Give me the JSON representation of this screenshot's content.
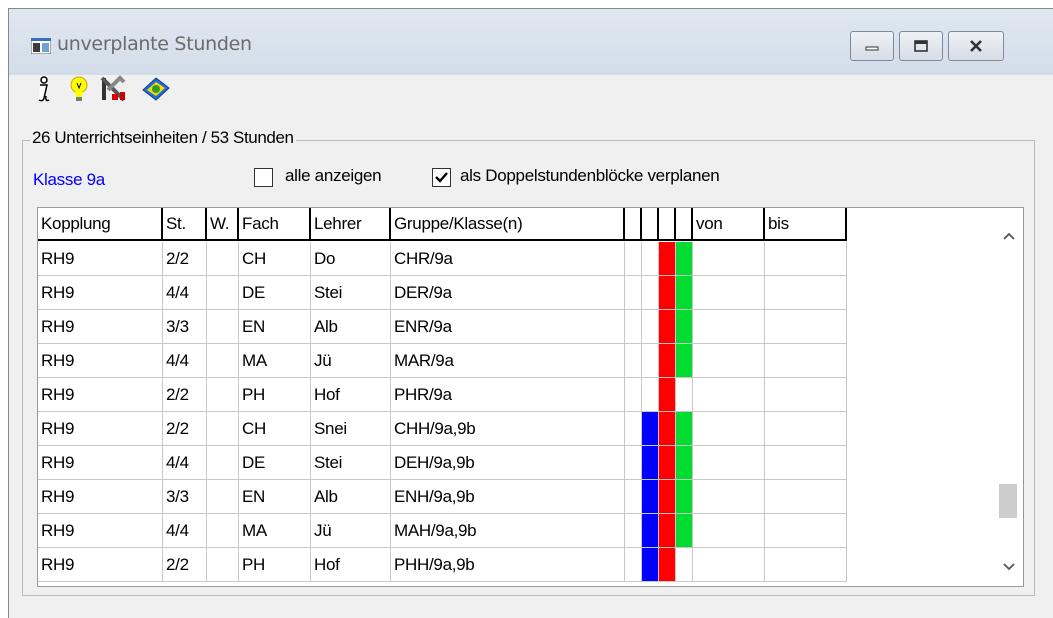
{
  "window": {
    "title": "unverplante Stunden",
    "buttons": [
      "minimize-icon",
      "maximize-icon",
      "close-icon"
    ]
  },
  "toolbar": {
    "icons": [
      "info-icon",
      "hint-bulb-icon",
      "tools-icon",
      "help-book-icon"
    ]
  },
  "group": {
    "title": "26 Unterrichtseinheiten / 53 Stunden",
    "klasse_label": "Klasse 9a",
    "show_all_label": "alle anzeigen",
    "show_all_checked": false,
    "double_block_label": "als Doppelstundenblöcke verplanen",
    "double_block_checked": true
  },
  "table": {
    "headers": [
      "Kopplung",
      "St.",
      "W.",
      "Fach",
      "Lehrer",
      "Gruppe/Klasse(n)",
      "",
      "",
      "",
      "",
      "von",
      "bis"
    ],
    "rows": [
      {
        "kopplung": "RH9",
        "st": "2/2",
        "w": "",
        "fach": "CH",
        "lehrer": "Do",
        "gruppe": "CHR/9a",
        "colors": [
          "",
          "",
          "red",
          "green"
        ],
        "von": "",
        "bis": ""
      },
      {
        "kopplung": "RH9",
        "st": "4/4",
        "w": "",
        "fach": "DE",
        "lehrer": "Stei",
        "gruppe": "DER/9a",
        "colors": [
          "",
          "",
          "red",
          "green"
        ],
        "von": "",
        "bis": ""
      },
      {
        "kopplung": "RH9",
        "st": "3/3",
        "w": "",
        "fach": "EN",
        "lehrer": "Alb",
        "gruppe": "ENR/9a",
        "colors": [
          "",
          "",
          "red",
          "green"
        ],
        "von": "",
        "bis": ""
      },
      {
        "kopplung": "RH9",
        "st": "4/4",
        "w": "",
        "fach": "MA",
        "lehrer": "Jü",
        "gruppe": "MAR/9a",
        "colors": [
          "",
          "",
          "red",
          "green"
        ],
        "von": "",
        "bis": ""
      },
      {
        "kopplung": "RH9",
        "st": "2/2",
        "w": "",
        "fach": "PH",
        "lehrer": "Hof",
        "gruppe": "PHR/9a",
        "colors": [
          "",
          "",
          "red",
          ""
        ],
        "von": "",
        "bis": ""
      },
      {
        "kopplung": "RH9",
        "st": "2/2",
        "w": "",
        "fach": "CH",
        "lehrer": "Snei",
        "gruppe": "CHH/9a,9b",
        "colors": [
          "",
          "blue",
          "red",
          "green"
        ],
        "von": "",
        "bis": ""
      },
      {
        "kopplung": "RH9",
        "st": "4/4",
        "w": "",
        "fach": "DE",
        "lehrer": "Stei",
        "gruppe": "DEH/9a,9b",
        "colors": [
          "",
          "blue",
          "red",
          "green"
        ],
        "von": "",
        "bis": ""
      },
      {
        "kopplung": "RH9",
        "st": "3/3",
        "w": "",
        "fach": "EN",
        "lehrer": "Alb",
        "gruppe": "ENH/9a,9b",
        "colors": [
          "",
          "blue",
          "red",
          "green"
        ],
        "von": "",
        "bis": ""
      },
      {
        "kopplung": "RH9",
        "st": "4/4",
        "w": "",
        "fach": "MA",
        "lehrer": "Jü",
        "gruppe": "MAH/9a,9b",
        "colors": [
          "",
          "blue",
          "red",
          "green"
        ],
        "von": "",
        "bis": ""
      },
      {
        "kopplung": "RH9",
        "st": "2/2",
        "w": "",
        "fach": "PH",
        "lehrer": "Hof",
        "gruppe": "PHH/9a,9b",
        "colors": [
          "",
          "blue",
          "red",
          ""
        ],
        "von": "",
        "bis": ""
      }
    ],
    "color_map": {
      "red": "#ff0000",
      "green": "#00dc32",
      "blue": "#0000ff"
    }
  },
  "scrollbar": {
    "icons": [
      "scroll-up-icon",
      "scroll-down-icon"
    ]
  }
}
